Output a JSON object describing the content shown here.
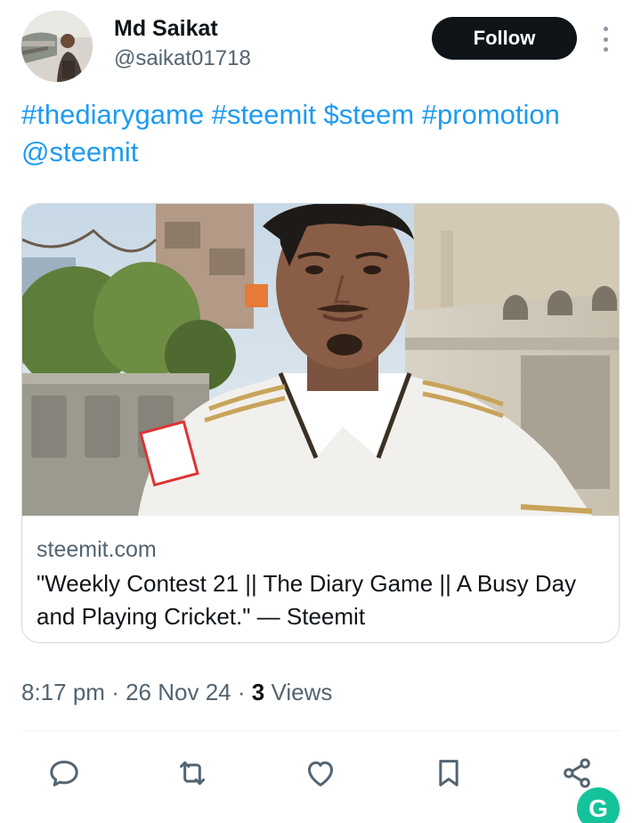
{
  "author": {
    "name": "Md Saikat",
    "handle": "@saikat01718",
    "follow_label": "Follow"
  },
  "tweet": {
    "tags": [
      "#thediarygame",
      "#steemit",
      "$steem",
      "#promotion",
      "@steemit"
    ]
  },
  "card": {
    "domain": "steemit.com",
    "title": "\"Weekly Contest 21 || The Diary Game || A Busy Day and Playing Cricket.\" — Steemit",
    "image_icon": "photo-of-man-in-white-polo-shirt"
  },
  "meta": {
    "time": "8:17 pm",
    "date": "26 Nov 24",
    "separator": "·",
    "views_count": "3",
    "views_label": "Views"
  },
  "actions": {
    "icons": [
      "reply-icon",
      "retweet-icon",
      "like-icon",
      "bookmark-icon",
      "share-icon"
    ]
  },
  "colors": {
    "link": "#1d9bf0",
    "text": "#0f1419",
    "secondary": "#536471",
    "follow_bg": "#0f1419",
    "grammarly": "#15c39a"
  },
  "grammarly": {
    "letter": "G"
  }
}
